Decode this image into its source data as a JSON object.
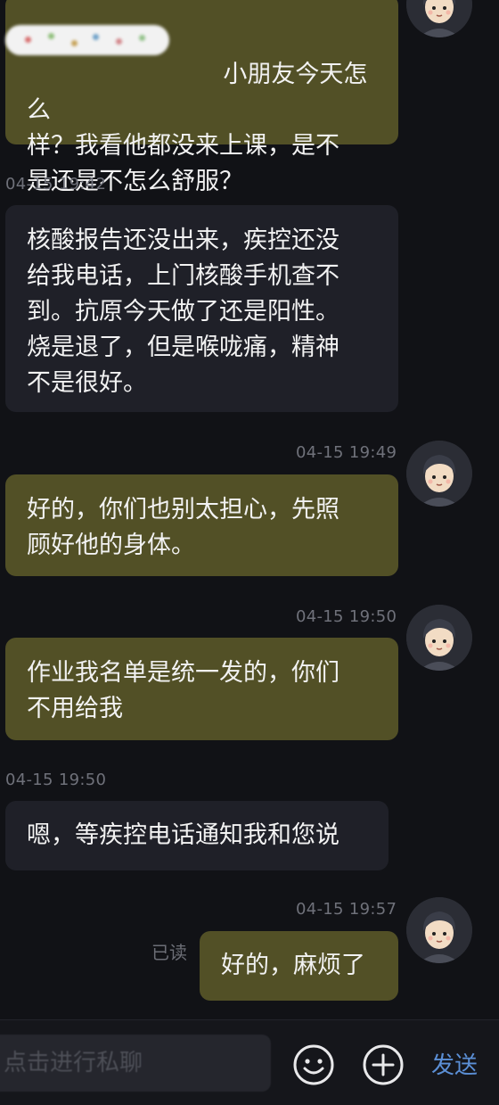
{
  "messages": [
    {
      "id": "m1",
      "direction": "sent",
      "text_visible": "小朋友今天怎么\n样？我看他都没来上课，是不\n是还是不怎么舒服？"
    },
    {
      "id": "m2",
      "direction": "received",
      "time": "04-15 19:42",
      "text": "核酸报告还没出来，疾控还没\n给我电话，上门核酸手机查不\n到。抗原今天做了还是阳性。\n烧是退了，但是喉咙痛，精神\n不是很好。"
    },
    {
      "id": "m3",
      "direction": "sent",
      "time": "04-15 19:49",
      "text": "好的，你们也别太担心，先照\n顾好他的身体。"
    },
    {
      "id": "m4",
      "direction": "sent",
      "time": "04-15 19:50",
      "text": "作业我名单是统一发的，你们\n不用给我"
    },
    {
      "id": "m5",
      "direction": "received",
      "time": "04-15 19:50",
      "text": "嗯，等疾控电话通知我和您说"
    },
    {
      "id": "m6",
      "direction": "sent",
      "time": "04-15 19:57",
      "text": "好的，麻烦了",
      "status": "已读"
    }
  ],
  "input": {
    "placeholder": "点击进行私聊"
  },
  "actions": {
    "send_label": "发送",
    "emoji_icon": "smiley-icon",
    "add_icon": "plus-circle-icon"
  },
  "colors": {
    "background": "#111216",
    "sent_bubble": "#525026",
    "received_bubble": "#1f2028",
    "send_text": "#5b8fd6"
  }
}
